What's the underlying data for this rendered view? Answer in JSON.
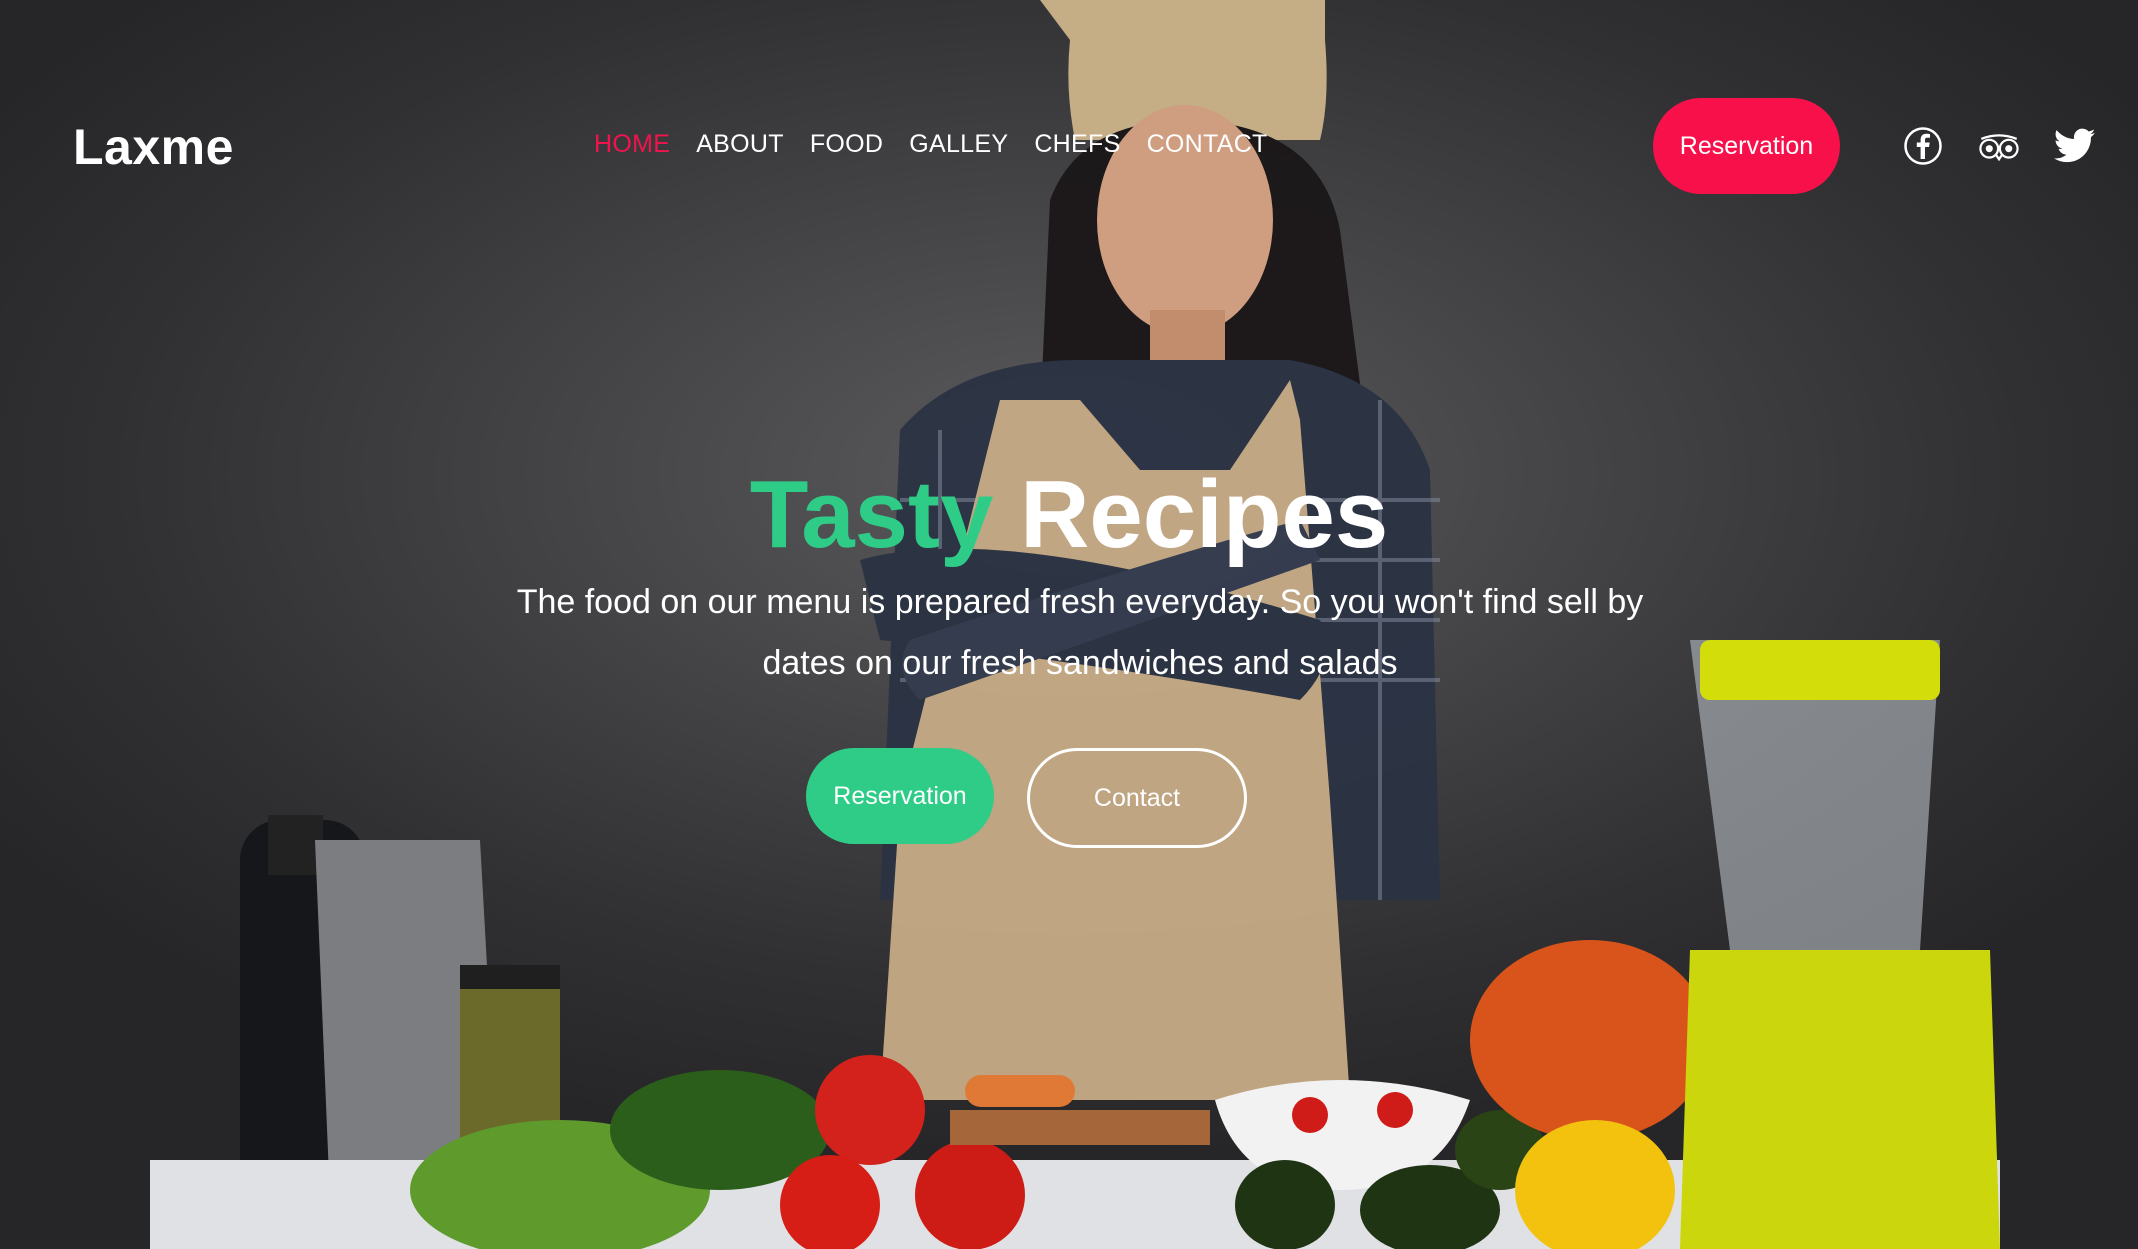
{
  "brand": {
    "logo": "Laxme"
  },
  "nav": {
    "items": [
      {
        "label": "HOME",
        "active": true
      },
      {
        "label": "ABOUT",
        "active": false
      },
      {
        "label": "FOOD",
        "active": false
      },
      {
        "label": "GALLEY",
        "active": false
      },
      {
        "label": "CHEFS",
        "active": false
      },
      {
        "label": "CONTACT",
        "active": false
      }
    ],
    "reservation_label": "Reservation",
    "social": [
      "facebook-icon",
      "tripadvisor-icon",
      "twitter-icon"
    ]
  },
  "hero": {
    "headline_accent": "Tasty",
    "headline_main": "Recipes",
    "subtext": "The food on our menu is prepared fresh everyday. So you won't find sell by dates on our fresh sandwiches and salads",
    "primary_button": "Reservation",
    "secondary_button": "Contact"
  },
  "colors": {
    "accent_red": "#f8104b",
    "accent_green": "#2ecc87",
    "text": "#ffffff"
  }
}
